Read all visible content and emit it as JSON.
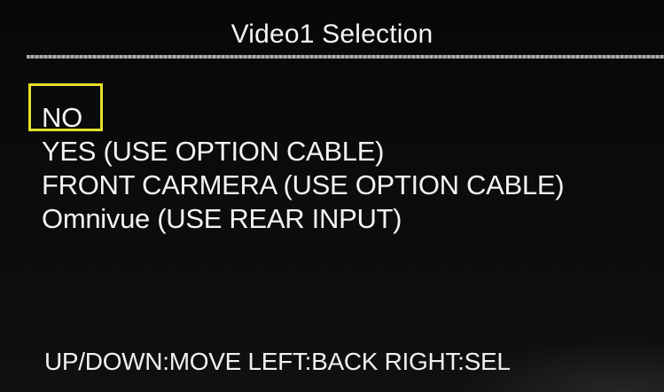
{
  "header": {
    "title": "Video1 Selection"
  },
  "menu": {
    "options": [
      {
        "label": "NO",
        "selected": true
      },
      {
        "label": "YES (USE OPTION CABLE)",
        "selected": false
      },
      {
        "label": "FRONT CARMERA (USE OPTION CABLE)",
        "selected": false
      },
      {
        "label": "Omnivue (USE REAR INPUT)",
        "selected": false
      }
    ],
    "selection_color": "#e6df2a"
  },
  "footer": {
    "hint": "UP/DOWN:MOVE  LEFT:BACK  RIGHT:SEL"
  }
}
